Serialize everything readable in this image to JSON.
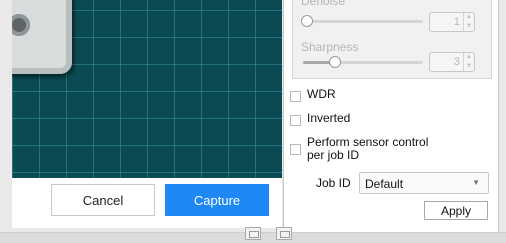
{
  "preview": {
    "action_bar": {
      "cancel_label": "Cancel",
      "capture_label": "Capture"
    }
  },
  "panel": {
    "denoise": {
      "label": "Denoise",
      "value": "1",
      "level": 0.0
    },
    "sharpness": {
      "label": "Sharpness",
      "value": "3",
      "level": 0.25
    },
    "checkboxes": [
      {
        "label": "WDR",
        "checked": false
      },
      {
        "label": "Inverted",
        "checked": false
      },
      {
        "label": "Perform sensor control per job ID",
        "checked": false
      }
    ],
    "job_id": {
      "label": "Job ID",
      "selected": "Default"
    },
    "apply_label": "Apply"
  },
  "colors": {
    "accent": "#1e88f5",
    "preview_background": "#0b4a52"
  },
  "icons": [
    "spin-up-icon",
    "spin-down-icon",
    "dropdown-caret-icon",
    "view-toggle-icon"
  ]
}
